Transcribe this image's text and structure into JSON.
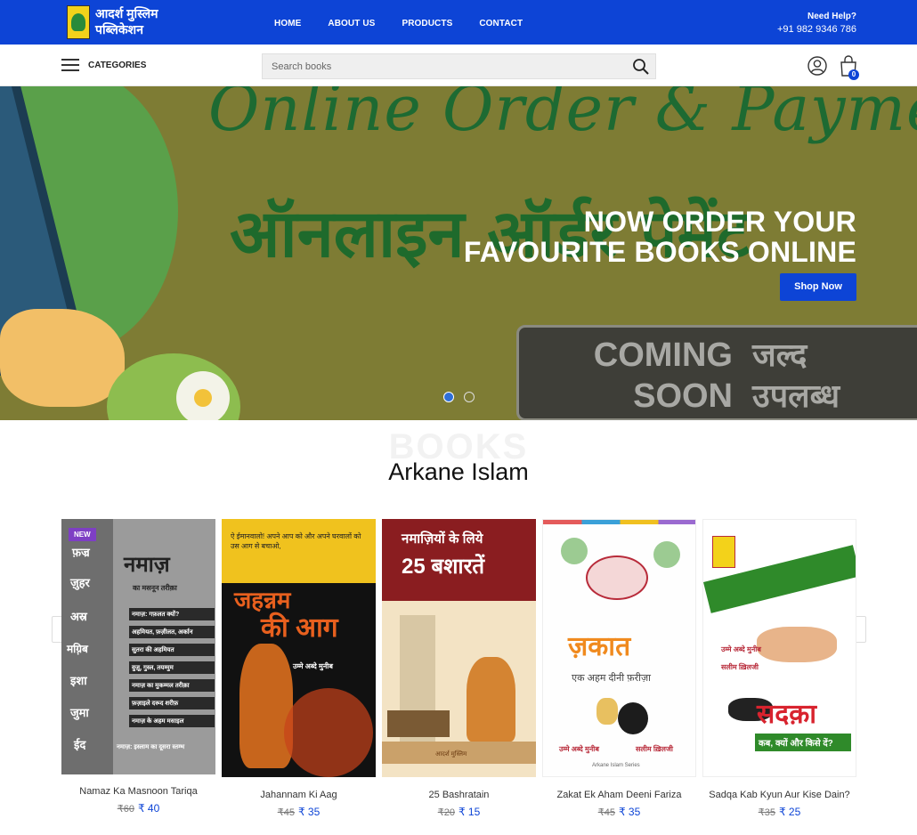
{
  "topbar": {
    "logo_text_line1": "आदर्श मुस्लिम",
    "logo_text_line2": "पब्लिकेशन",
    "nav": [
      "HOME",
      "ABOUT US",
      "PRODUCTS",
      "CONTACT"
    ],
    "help_title": "Need Help?",
    "help_phone": "+91 982 9346 786"
  },
  "subbar": {
    "categories_label": "CATEGORIES",
    "search_placeholder": "Search books",
    "cart_count": "0"
  },
  "hero": {
    "script_text": "Online Order & Payment",
    "hindi_text": "ऑनलाइन ऑर्डर पेमेंट",
    "heading_line1": "NOW ORDER YOUR",
    "heading_line2": "FAVOURITE BOOKS ONLINE",
    "button": "Shop Now",
    "coming_line1": "COMING",
    "coming_line2": "SOON",
    "coming_hi_line1": "जल्द",
    "coming_hi_line2": "उपलब्ध",
    "slides": 2,
    "active_slide": 1
  },
  "section": {
    "watermark": "BOOKS",
    "title": "Arkane Islam"
  },
  "products": [
    {
      "name": "Namaz Ka Masnoon Tariqa",
      "old_price": "₹60",
      "price": "₹ 40",
      "badge": "NEW",
      "cover_title": "नमाज़",
      "cover_sub": "का मसनून तरीक़ा",
      "cover_side": [
        "फ़ज्र",
        "ज़ुहर",
        "अस्र",
        "मग़्रिब",
        "इशा",
        "जुमा",
        "ईद"
      ],
      "cover_items": [
        "नमाज़: गफ़लत क्यों?",
        "अहमियत, फ़ज़ीलत, अर्कान",
        "सुतरा की अहमियत",
        "वुज़ू, गुस्ल, तयम्मुम",
        "नमाज़ का मुकम्मल तरीक़ा",
        "फ़ज़ाइले दरूद शरीफ़",
        "नमाज़ के अहम मसाइल"
      ],
      "cover_footer": "नमाज़: इस्लाम का दूसरा स्तम्भ"
    },
    {
      "name": "Jahannam Ki Aag",
      "old_price": "₹45",
      "price": "₹ 35",
      "cover_verse": "ऐ ईमानवालो! अपने आप को और अपने घरवालों को उस आग से बचाओ,",
      "cover_title_1": "जहन्नम",
      "cover_title_2": "की आग",
      "cover_credit": "उम्मे अब्दे मुनीब"
    },
    {
      "name": "25 Bashratain",
      "old_price": "₹20",
      "price": "₹ 15",
      "cover_line1": "नमाज़ियों के लिये",
      "cover_line2": "25 बशारतें",
      "cover_footer": "आदर्श मुस्लिम"
    },
    {
      "name": "Zakat Ek Aham Deeni Fariza",
      "old_price": "₹45",
      "price": "₹ 35",
      "cover_title": "ज़कात",
      "cover_sub": "एक अहम दीनी फ़रीज़ा",
      "cover_credit1": "उम्मे अब्दे मुनीब",
      "cover_credit2": "सलीम ख़िलजी",
      "cover_series": "Arkane Islam Series"
    },
    {
      "name": "Sadqa Kab Kyun Aur Kise Dain?",
      "old_price": "₹35",
      "price": "₹ 25",
      "cover_title": "सदक़ा",
      "cover_sub": "कब, क्यों और किसे दें?",
      "cover_credit1": "उम्मे अब्दे मुनीब",
      "cover_credit2": "सलीम ख़िलजी"
    }
  ],
  "colors": {
    "primary": "#0d44d6",
    "hero_bg": "#7e7c34",
    "badge": "#7e3fc4"
  }
}
